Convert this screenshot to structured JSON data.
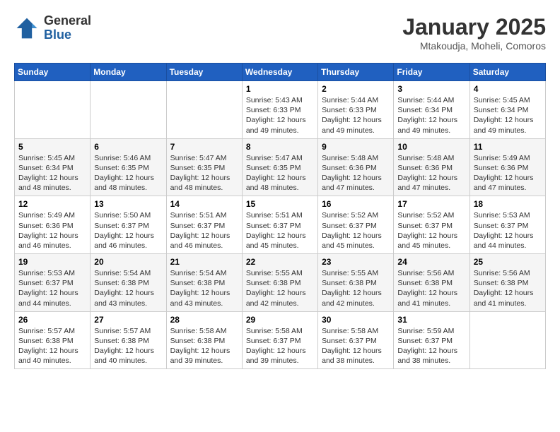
{
  "header": {
    "logo": {
      "general": "General",
      "blue": "Blue"
    },
    "title": "January 2025",
    "subtitle": "Mtakoudja, Moheli, Comoros"
  },
  "days_of_week": [
    "Sunday",
    "Monday",
    "Tuesday",
    "Wednesday",
    "Thursday",
    "Friday",
    "Saturday"
  ],
  "weeks": [
    [
      {
        "day": "",
        "info": ""
      },
      {
        "day": "",
        "info": ""
      },
      {
        "day": "",
        "info": ""
      },
      {
        "day": "1",
        "info": "Sunrise: 5:43 AM\nSunset: 6:33 PM\nDaylight: 12 hours and 49 minutes."
      },
      {
        "day": "2",
        "info": "Sunrise: 5:44 AM\nSunset: 6:33 PM\nDaylight: 12 hours and 49 minutes."
      },
      {
        "day": "3",
        "info": "Sunrise: 5:44 AM\nSunset: 6:34 PM\nDaylight: 12 hours and 49 minutes."
      },
      {
        "day": "4",
        "info": "Sunrise: 5:45 AM\nSunset: 6:34 PM\nDaylight: 12 hours and 49 minutes."
      }
    ],
    [
      {
        "day": "5",
        "info": "Sunrise: 5:45 AM\nSunset: 6:34 PM\nDaylight: 12 hours and 48 minutes."
      },
      {
        "day": "6",
        "info": "Sunrise: 5:46 AM\nSunset: 6:35 PM\nDaylight: 12 hours and 48 minutes."
      },
      {
        "day": "7",
        "info": "Sunrise: 5:47 AM\nSunset: 6:35 PM\nDaylight: 12 hours and 48 minutes."
      },
      {
        "day": "8",
        "info": "Sunrise: 5:47 AM\nSunset: 6:35 PM\nDaylight: 12 hours and 48 minutes."
      },
      {
        "day": "9",
        "info": "Sunrise: 5:48 AM\nSunset: 6:36 PM\nDaylight: 12 hours and 47 minutes."
      },
      {
        "day": "10",
        "info": "Sunrise: 5:48 AM\nSunset: 6:36 PM\nDaylight: 12 hours and 47 minutes."
      },
      {
        "day": "11",
        "info": "Sunrise: 5:49 AM\nSunset: 6:36 PM\nDaylight: 12 hours and 47 minutes."
      }
    ],
    [
      {
        "day": "12",
        "info": "Sunrise: 5:49 AM\nSunset: 6:36 PM\nDaylight: 12 hours and 46 minutes."
      },
      {
        "day": "13",
        "info": "Sunrise: 5:50 AM\nSunset: 6:37 PM\nDaylight: 12 hours and 46 minutes."
      },
      {
        "day": "14",
        "info": "Sunrise: 5:51 AM\nSunset: 6:37 PM\nDaylight: 12 hours and 46 minutes."
      },
      {
        "day": "15",
        "info": "Sunrise: 5:51 AM\nSunset: 6:37 PM\nDaylight: 12 hours and 45 minutes."
      },
      {
        "day": "16",
        "info": "Sunrise: 5:52 AM\nSunset: 6:37 PM\nDaylight: 12 hours and 45 minutes."
      },
      {
        "day": "17",
        "info": "Sunrise: 5:52 AM\nSunset: 6:37 PM\nDaylight: 12 hours and 45 minutes."
      },
      {
        "day": "18",
        "info": "Sunrise: 5:53 AM\nSunset: 6:37 PM\nDaylight: 12 hours and 44 minutes."
      }
    ],
    [
      {
        "day": "19",
        "info": "Sunrise: 5:53 AM\nSunset: 6:37 PM\nDaylight: 12 hours and 44 minutes."
      },
      {
        "day": "20",
        "info": "Sunrise: 5:54 AM\nSunset: 6:38 PM\nDaylight: 12 hours and 43 minutes."
      },
      {
        "day": "21",
        "info": "Sunrise: 5:54 AM\nSunset: 6:38 PM\nDaylight: 12 hours and 43 minutes."
      },
      {
        "day": "22",
        "info": "Sunrise: 5:55 AM\nSunset: 6:38 PM\nDaylight: 12 hours and 42 minutes."
      },
      {
        "day": "23",
        "info": "Sunrise: 5:55 AM\nSunset: 6:38 PM\nDaylight: 12 hours and 42 minutes."
      },
      {
        "day": "24",
        "info": "Sunrise: 5:56 AM\nSunset: 6:38 PM\nDaylight: 12 hours and 41 minutes."
      },
      {
        "day": "25",
        "info": "Sunrise: 5:56 AM\nSunset: 6:38 PM\nDaylight: 12 hours and 41 minutes."
      }
    ],
    [
      {
        "day": "26",
        "info": "Sunrise: 5:57 AM\nSunset: 6:38 PM\nDaylight: 12 hours and 40 minutes."
      },
      {
        "day": "27",
        "info": "Sunrise: 5:57 AM\nSunset: 6:38 PM\nDaylight: 12 hours and 40 minutes."
      },
      {
        "day": "28",
        "info": "Sunrise: 5:58 AM\nSunset: 6:38 PM\nDaylight: 12 hours and 39 minutes."
      },
      {
        "day": "29",
        "info": "Sunrise: 5:58 AM\nSunset: 6:37 PM\nDaylight: 12 hours and 39 minutes."
      },
      {
        "day": "30",
        "info": "Sunrise: 5:58 AM\nSunset: 6:37 PM\nDaylight: 12 hours and 38 minutes."
      },
      {
        "day": "31",
        "info": "Sunrise: 5:59 AM\nSunset: 6:37 PM\nDaylight: 12 hours and 38 minutes."
      },
      {
        "day": "",
        "info": ""
      }
    ]
  ]
}
